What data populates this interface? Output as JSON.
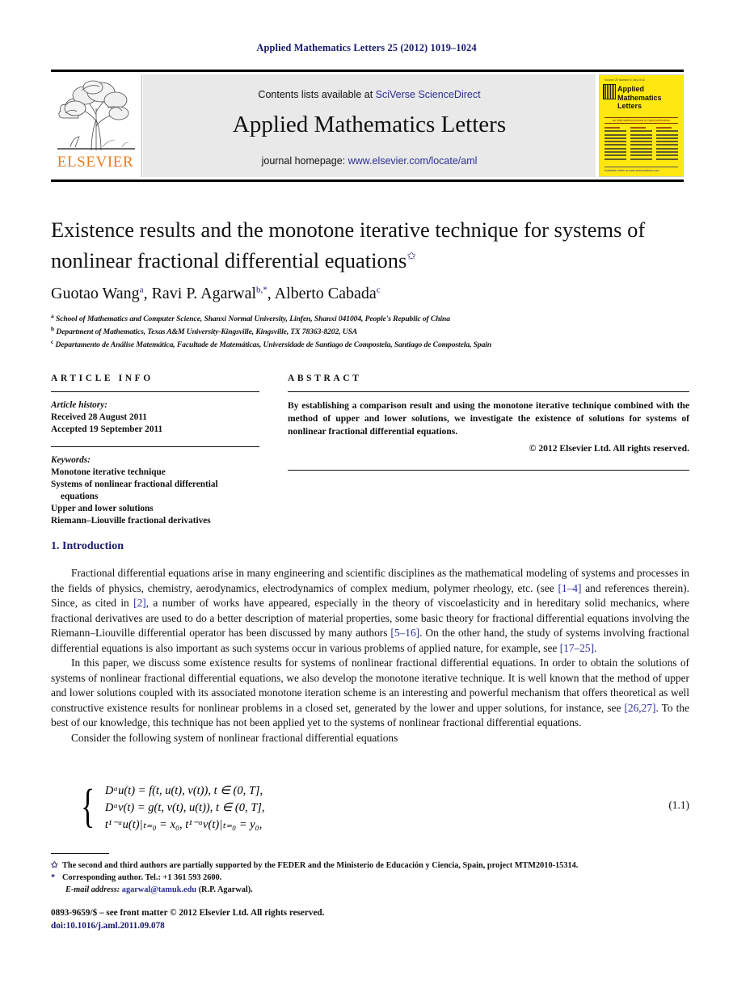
{
  "running_head": "Applied Mathematics Letters 25 (2012) 1019–1024",
  "banner": {
    "contents_prefix": "Contents lists available at ",
    "contents_link": "SciVerse ScienceDirect",
    "journal_name": "Applied Mathematics Letters",
    "homepage_prefix": "journal homepage: ",
    "homepage_link": "www.elsevier.com/locate/aml",
    "publisher": "ELSEVIER"
  },
  "cover": {
    "top_strip": "Volume 25  Number 6  July 2012",
    "title_line1": "Applied",
    "title_line2": "Mathematics",
    "title_line3": "Letters",
    "subtitle": "an international journal of rapid publication",
    "bottom": "Available online at www.sciencedirect.com"
  },
  "article": {
    "title": "Existence results and the monotone iterative technique for systems of nonlinear fractional differential equations",
    "title_footnote_mark": "✩",
    "authors": [
      {
        "name": "Guotao Wang",
        "sup": "a"
      },
      {
        "name": "Ravi P. Agarwal",
        "sup": "b,*"
      },
      {
        "name": "Alberto Cabada",
        "sup": "c"
      }
    ],
    "affiliations": [
      {
        "mark": "a",
        "text": "School of Mathematics and Computer Science, Shanxi Normal University, Linfen, Shanxi 041004, People's Republic of China"
      },
      {
        "mark": "b",
        "text": "Department of Mathematics, Texas A&M University-Kingsville, Kingsville, TX 78363-8202, USA"
      },
      {
        "mark": "c",
        "text": "Departamento de Análise Matemática, Facultade de Matemáticas, Universidade de Santiago de Compostela, Santiago de Compostela, Spain"
      }
    ]
  },
  "article_info": {
    "heading": "ARTICLE INFO",
    "history_label": "Article history:",
    "received": "Received 28 August 2011",
    "accepted": "Accepted 19 September 2011",
    "keywords_label": "Keywords:",
    "keywords": [
      "Monotone iterative technique",
      "Systems of nonlinear fractional differential",
      "equations",
      "Upper and lower solutions",
      "Riemann–Liouville fractional derivatives"
    ]
  },
  "abstract": {
    "heading": "ABSTRACT",
    "text": "By establishing a comparison result and using the monotone iterative technique combined with the method of upper and lower solutions, we investigate the existence of solutions for systems of nonlinear fractional differential equations.",
    "copyright": "© 2012 Elsevier Ltd. All rights reserved."
  },
  "section": {
    "number_title": "1. Introduction",
    "para1_a": "Fractional differential equations arise in many engineering and scientific disciplines as the mathematical modeling of systems and processes in the fields of physics, chemistry, aerodynamics, electrodynamics of complex medium, polymer rheology, etc. (see ",
    "ref_1_4": "[1–4]",
    "para1_b": " and references therein). Since, as cited in ",
    "ref_2": "[2]",
    "para1_c": ", a number of works have appeared, especially in the theory of viscoelasticity and in hereditary solid mechanics, where fractional derivatives are used to do a better description of material properties, some basic theory for fractional differential equations involving the Riemann–Liouville differential operator has been discussed by many authors ",
    "ref_5_16": "[5–16]",
    "para1_d": ". On the other hand, the study of systems involving fractional differential equations is also important as such systems occur in various problems of applied nature, for example, see ",
    "ref_17_25": "[17–25]",
    "para1_e": ".",
    "para2_a": "In this paper, we discuss some existence results for systems of nonlinear fractional differential equations. In order to obtain the solutions of systems of nonlinear fractional differential equations, we also develop the monotone iterative technique. It is well known that the method of upper and lower solutions coupled with its associated monotone iteration scheme is an interesting and powerful mechanism that offers theoretical as well constructive existence results for nonlinear problems in a closed set, generated by the lower and upper solutions, for instance, see ",
    "ref_26_27": "[26,27]",
    "para2_b": ". To the best of our knowledge, this technique has not been applied yet to the systems of nonlinear fractional differential equations.",
    "para3": "Consider the following system of nonlinear fractional differential equations"
  },
  "equation": {
    "line1": "Dᵅu(t) = f(t, u(t), v(t)),     t ∈ (0, T],",
    "line2": "Dᵅv(t) = g(t, v(t), u(t)),     t ∈ (0, T],",
    "line3": "t¹⁻ᵅu(t)|ₜ₌₀ = x₀,          t¹⁻ᵅv(t)|ₜ₌₀ = y₀,",
    "number": "(1.1)"
  },
  "footnotes": {
    "star_mark": "✩",
    "star_text": "The second and third authors are partially supported by the FEDER and the Ministerio de Educación y Ciencia, Spain, project MTM2010-15314.",
    "corr_mark": "*",
    "corr_text": "Corresponding author. Tel.: +1 361 593 2600.",
    "email_label": "E-mail address:",
    "email": "agarwal@tamuk.edu",
    "email_owner": "(R.P. Agarwal)."
  },
  "imprint": {
    "issn_line": "0893-9659/$ – see front matter © 2012 Elsevier Ltd. All rights reserved.",
    "doi": "doi:10.1016/j.aml.2011.09.078"
  },
  "colors": {
    "link_blue": "#2b2f98",
    "navy": "#1a1a6e",
    "elsevier_orange": "#e87d1e",
    "cover_yellow": "#ffe711",
    "banner_gray": "#e9e9e9"
  }
}
